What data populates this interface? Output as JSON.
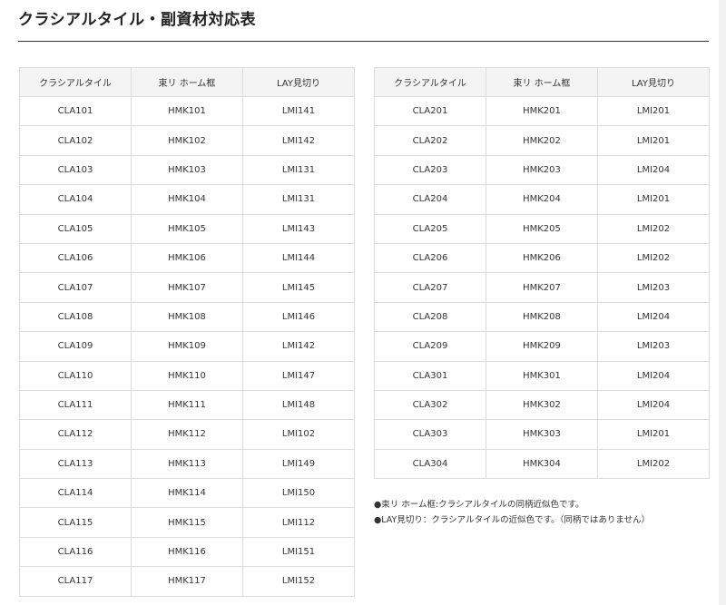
{
  "page": {
    "title": "クラシアルタイル・副資材対応表"
  },
  "table_left": {
    "headers": [
      "クラシアルタイル",
      "束リ ホーム框",
      "LAY見切り"
    ],
    "rows": [
      [
        "CLA101",
        "HMK101",
        "LMI141"
      ],
      [
        "CLA102",
        "HMK102",
        "LMI142"
      ],
      [
        "CLA103",
        "HMK103",
        "LMI131"
      ],
      [
        "CLA104",
        "HMK104",
        "LMI131"
      ],
      [
        "CLA105",
        "HMK105",
        "LMI143"
      ],
      [
        "CLA106",
        "HMK106",
        "LMI144"
      ],
      [
        "CLA107",
        "HMK107",
        "LMI145"
      ],
      [
        "CLA108",
        "HMK108",
        "LMI146"
      ],
      [
        "CLA109",
        "HMK109",
        "LMI142"
      ],
      [
        "CLA110",
        "HMK110",
        "LMI147"
      ],
      [
        "CLA111",
        "HMK111",
        "LMI148"
      ],
      [
        "CLA112",
        "HMK112",
        "LMI102"
      ],
      [
        "CLA113",
        "HMK113",
        "LMI149"
      ],
      [
        "CLA114",
        "HMK114",
        "LMI150"
      ],
      [
        "CLA115",
        "HMK115",
        "LMI112"
      ],
      [
        "CLA116",
        "HMK116",
        "LMI151"
      ],
      [
        "CLA117",
        "HMK117",
        "LMI152"
      ]
    ]
  },
  "table_right": {
    "headers": [
      "クラシアルタイル",
      "束リ ホーム框",
      "LAY見切り"
    ],
    "rows": [
      [
        "CLA201",
        "HMK201",
        "LMI201"
      ],
      [
        "CLA202",
        "HMK202",
        "LMI201"
      ],
      [
        "CLA203",
        "HMK203",
        "LMI204"
      ],
      [
        "CLA204",
        "HMK204",
        "LMI201"
      ],
      [
        "CLA205",
        "HMK205",
        "LMI202"
      ],
      [
        "CLA206",
        "HMK206",
        "LMI202"
      ],
      [
        "CLA207",
        "HMK207",
        "LMI203"
      ],
      [
        "CLA208",
        "HMK208",
        "LMI204"
      ],
      [
        "CLA209",
        "HMK209",
        "LMI203"
      ],
      [
        "CLA301",
        "HMK301",
        "LMI204"
      ],
      [
        "CLA302",
        "HMK302",
        "LMI204"
      ],
      [
        "CLA303",
        "HMK303",
        "LMI201"
      ],
      [
        "CLA304",
        "HMK304",
        "LMI202"
      ]
    ]
  },
  "notes": [
    "●束リ ホーム框:クラシアルタイルの同柄近似色です。",
    "●LAY見切り：クラシアルタイルの近似色です。（同柄ではありません）"
  ],
  "colors": {
    "header_bg": "#f4f4f4",
    "border": "#dcdcdc",
    "text": "#333333",
    "rule": "#333333"
  }
}
